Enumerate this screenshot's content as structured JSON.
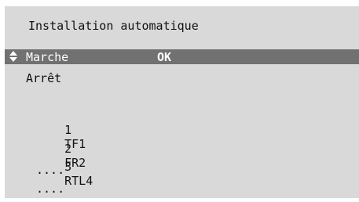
{
  "screen": {
    "title": "Installation automatique"
  },
  "menu": {
    "items": [
      {
        "label": "Marche",
        "selected": true,
        "status": "OK"
      },
      {
        "label": "Arrêt",
        "selected": false
      }
    ],
    "selector_icon": "up-down-arrow-icon"
  },
  "channels": [
    {
      "number": "1",
      "name": "TF1"
    },
    {
      "number": "2",
      "name": "FR2"
    },
    {
      "number": "3",
      "name": "RTL4"
    }
  ],
  "ellipsis_rows": [
    "....",
    "...."
  ],
  "colors": {
    "background": "#d9d9d9",
    "selection_bar": "#717171",
    "text": "#111111",
    "selected_text": "#ffffff"
  }
}
